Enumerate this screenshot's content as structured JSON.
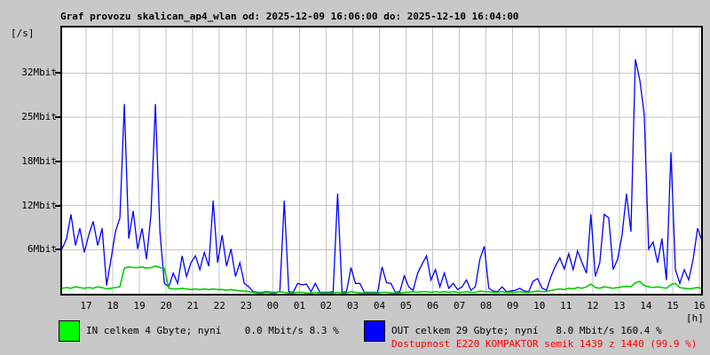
{
  "title": "Graf provozu skalican_ap4_wlan od: 2025-12-09 16:06:00 do: 2025-12-10 16:04:00",
  "y_unit": "[/s]",
  "x_unit": "[h]",
  "legend": {
    "in_label": "IN celkem 4 Gbyte; nyní    0.0 Mbit/s 8.3 %",
    "in_swatch_color": "#00ff00",
    "out_label": "OUT celkem 29 Gbyte; nyní   8.0 Mbit/s 160.4 %",
    "out_swatch_color": "#0000ff",
    "availability_text": "Dostupnost E220 KOMPAKTOR semik 1439 z 1440 (99.9 %)",
    "availability_color": "#ff0000"
  },
  "colors": {
    "background": "#c8c8c8",
    "plot_background": "#ffffff",
    "grid": "#c6c6c6",
    "frame": "#000000",
    "in_line": "#00cc00",
    "out_line": "#0000ff"
  },
  "chart_data": {
    "type": "line",
    "title": "Graf provozu skalican_ap4_wlan od: 2025-12-09 16:06:00 do: 2025-12-10 16:04:00",
    "ylabel": "[/s]",
    "xlabel": "[h]",
    "x_start_time": "16:06",
    "x_end_time": "16:04",
    "x_total_minutes": 1438,
    "sample_interval_min": 10,
    "ylim": [
      0,
      38.6
    ],
    "grid": true,
    "legend_position": "bottom",
    "y_ticks": [
      {
        "label": "6Mbit",
        "value": 6.4
      },
      {
        "label": "12Mbit",
        "value": 12.8
      },
      {
        "label": "18Mbit",
        "value": 19.2
      },
      {
        "label": "25Mbit",
        "value": 25.6
      },
      {
        "label": "32Mbit",
        "value": 32.0
      }
    ],
    "x_tick_labels": [
      "17",
      "18",
      "19",
      "20",
      "21",
      "22",
      "23",
      "00",
      "01",
      "02",
      "03",
      "04",
      "05",
      "06",
      "07",
      "08",
      "09",
      "10",
      "11",
      "12",
      "13",
      "14",
      "15",
      "16"
    ],
    "x_first_tick_minute": 54,
    "x_tick_step_minutes": 60,
    "series": [
      {
        "name": "OUT",
        "unit": "Mbit/s",
        "values": [
          6.5,
          8.0,
          11.5,
          7.0,
          9.5,
          6.0,
          8.5,
          10.5,
          7.0,
          9.5,
          1.2,
          5.0,
          9.0,
          11.0,
          27.5,
          8.0,
          12.0,
          6.5,
          9.5,
          5.0,
          11.5,
          27.5,
          9.0,
          1.5,
          1.0,
          3.0,
          1.5,
          5.5,
          2.5,
          4.5,
          5.5,
          3.5,
          6.0,
          4.0,
          13.5,
          4.5,
          8.5,
          4.0,
          6.5,
          2.5,
          4.5,
          1.5,
          1.0,
          0.3,
          0.2,
          0.2,
          0.3,
          0.2,
          0.2,
          0.3,
          13.5,
          0.3,
          0.2,
          1.5,
          1.3,
          1.4,
          0.3,
          1.5,
          0.2,
          0.2,
          0.2,
          0.3,
          14.5,
          0.2,
          0.3,
          3.8,
          1.5,
          1.5,
          0.2,
          0.2,
          0.2,
          0.2,
          3.9,
          1.6,
          1.5,
          0.2,
          0.3,
          2.6,
          1.0,
          0.5,
          3.0,
          4.3,
          5.5,
          2.0,
          3.5,
          1.0,
          3.0,
          0.8,
          1.5,
          0.6,
          1.0,
          2.0,
          0.5,
          1.0,
          5.0,
          6.9,
          0.8,
          0.4,
          0.3,
          1.0,
          0.3,
          0.4,
          0.5,
          0.8,
          0.4,
          0.3,
          1.8,
          2.2,
          0.8,
          0.5,
          2.5,
          4.0,
          5.2,
          3.6,
          5.8,
          3.5,
          6.2,
          4.5,
          3.0,
          11.5,
          2.5,
          4.5,
          11.5,
          11.0,
          3.5,
          5.0,
          8.5,
          14.5,
          9.0,
          34.0,
          31.0,
          26.0,
          6.5,
          7.5,
          4.5,
          8.0,
          2.0,
          20.5,
          3.5,
          1.5,
          3.5,
          2.0,
          5.0,
          9.5,
          8.0
        ]
      },
      {
        "name": "IN",
        "unit": "Mbit/s",
        "values": [
          0.8,
          0.9,
          0.8,
          1.0,
          0.9,
          0.8,
          0.9,
          0.8,
          1.0,
          0.9,
          0.7,
          0.8,
          0.9,
          1.0,
          3.7,
          3.9,
          3.8,
          3.8,
          3.9,
          3.7,
          3.8,
          4.0,
          3.8,
          3.7,
          0.8,
          0.7,
          0.7,
          0.8,
          0.7,
          0.6,
          0.7,
          0.6,
          0.7,
          0.6,
          0.7,
          0.6,
          0.6,
          0.5,
          0.6,
          0.5,
          0.4,
          0.4,
          0.3,
          0.2,
          0.1,
          0.1,
          0.2,
          0.1,
          0.1,
          0.3,
          0.2,
          0.1,
          0.1,
          0.2,
          0.2,
          0.1,
          0.1,
          0.2,
          0.1,
          0.1,
          0.1,
          0.1,
          0.2,
          0.1,
          0.1,
          0.3,
          0.2,
          0.1,
          0.1,
          0.1,
          0.1,
          0.1,
          0.2,
          0.2,
          0.1,
          0.1,
          0.1,
          0.2,
          0.2,
          0.3,
          0.2,
          0.3,
          0.3,
          0.2,
          0.3,
          0.2,
          0.3,
          0.2,
          0.3,
          0.2,
          0.2,
          0.3,
          0.2,
          0.2,
          0.4,
          0.3,
          0.3,
          0.2,
          0.2,
          0.3,
          0.2,
          0.2,
          0.2,
          0.3,
          0.2,
          0.2,
          0.3,
          0.4,
          0.3,
          0.3,
          0.5,
          0.6,
          0.7,
          0.6,
          0.8,
          0.7,
          0.9,
          0.8,
          1.0,
          1.4,
          0.9,
          0.8,
          1.0,
          0.9,
          0.8,
          0.9,
          1.0,
          1.1,
          1.0,
          1.6,
          1.8,
          1.2,
          1.0,
          0.9,
          1.0,
          0.9,
          0.8,
          1.3,
          1.5,
          0.9,
          0.8,
          0.7,
          0.8,
          0.9,
          0.8
        ]
      }
    ]
  }
}
